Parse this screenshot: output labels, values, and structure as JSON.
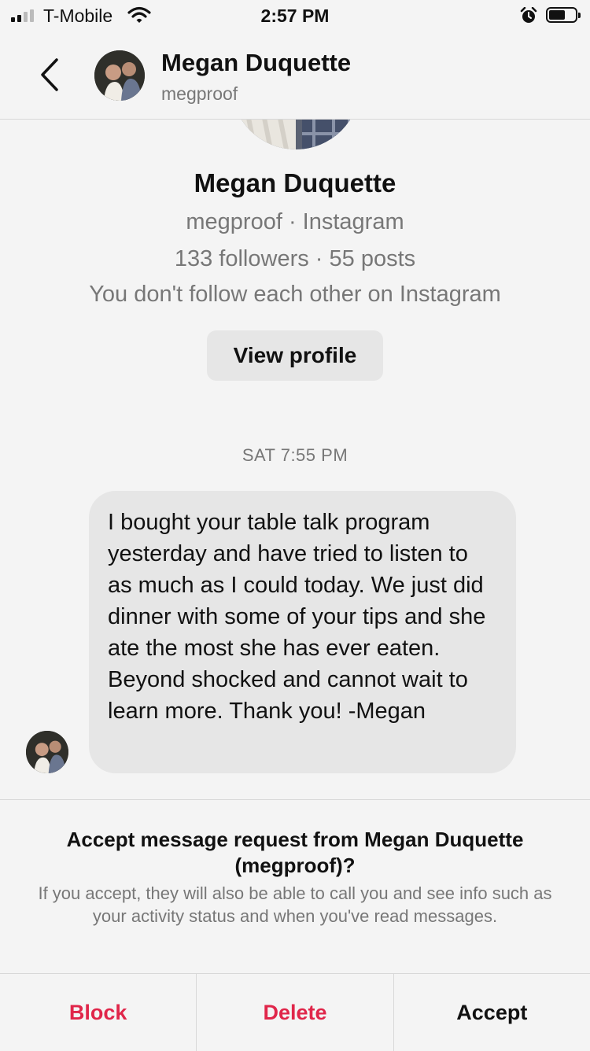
{
  "status_bar": {
    "carrier": "T-Mobile",
    "time": "2:57 PM"
  },
  "header": {
    "name": "Megan Duquette",
    "username": "megproof"
  },
  "profile": {
    "name": "Megan Duquette",
    "source_line": "megproof · Instagram",
    "stats_line": "133 followers · 55 posts",
    "follow_line": "You don't follow each other on Instagram",
    "view_profile_label": "View profile"
  },
  "conversation": {
    "timestamp": "SAT 7:55 PM",
    "message": "I bought your table talk program yesterday and have tried to listen to as much as I could today. We just did dinner with some of your tips and she ate the most she has ever eaten. Beyond shocked and cannot wait to learn more. Thank you! -Megan"
  },
  "request": {
    "title": "Accept message request from Megan Duquette (megproof)?",
    "body": "If you accept, they will also be able to call you and see info such as your activity status and when you've read messages.",
    "block_label": "Block",
    "delete_label": "Delete",
    "accept_label": "Accept"
  },
  "colors": {
    "danger": "#e0264a",
    "bubble": "#e6e6e6",
    "secondary_text": "#777777"
  },
  "icons": [
    "signal-icon",
    "wifi-icon",
    "alarm-icon",
    "battery-icon",
    "back-chevron-icon"
  ]
}
